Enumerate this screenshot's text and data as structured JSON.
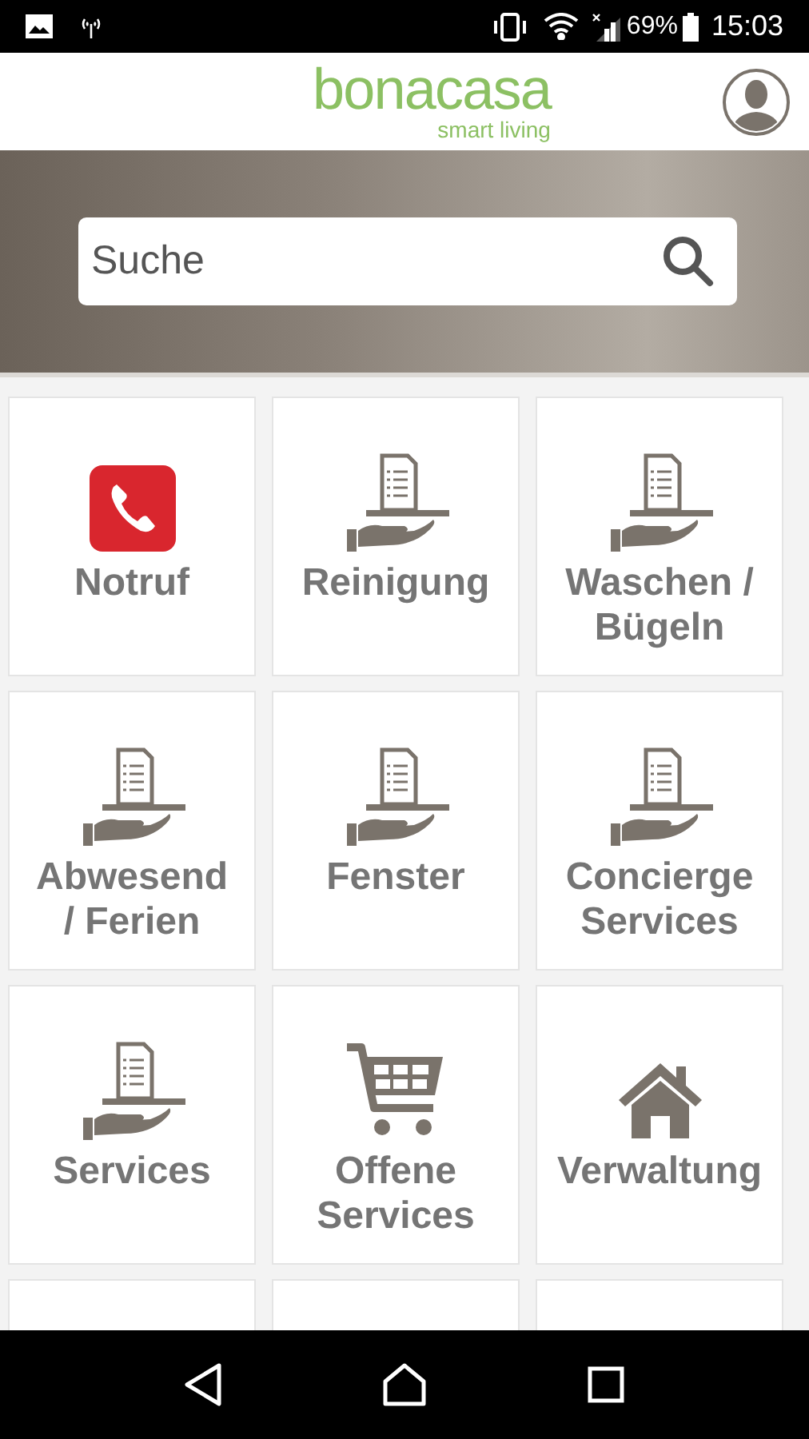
{
  "status_bar": {
    "battery": "69%",
    "time": "15:03"
  },
  "header": {
    "logo": "bonacasa",
    "tagline": "smart living"
  },
  "search": {
    "placeholder": "Suche"
  },
  "tiles": [
    {
      "kind": "phone",
      "label": "Notruf"
    },
    {
      "kind": "service",
      "label": "Reinigung"
    },
    {
      "kind": "service",
      "label": "Waschen /\nBügeln"
    },
    {
      "kind": "service",
      "label": "Abwesend\n/ Ferien"
    },
    {
      "kind": "service",
      "label": "Fenster"
    },
    {
      "kind": "service",
      "label": "Concierge\nServices"
    },
    {
      "kind": "service",
      "label": "Services"
    },
    {
      "kind": "cart",
      "label": "Offene\nServices"
    },
    {
      "kind": "home",
      "label": "Verwaltung"
    },
    {
      "kind": "blank"
    },
    {
      "kind": "blank"
    },
    {
      "kind": "blank"
    }
  ]
}
